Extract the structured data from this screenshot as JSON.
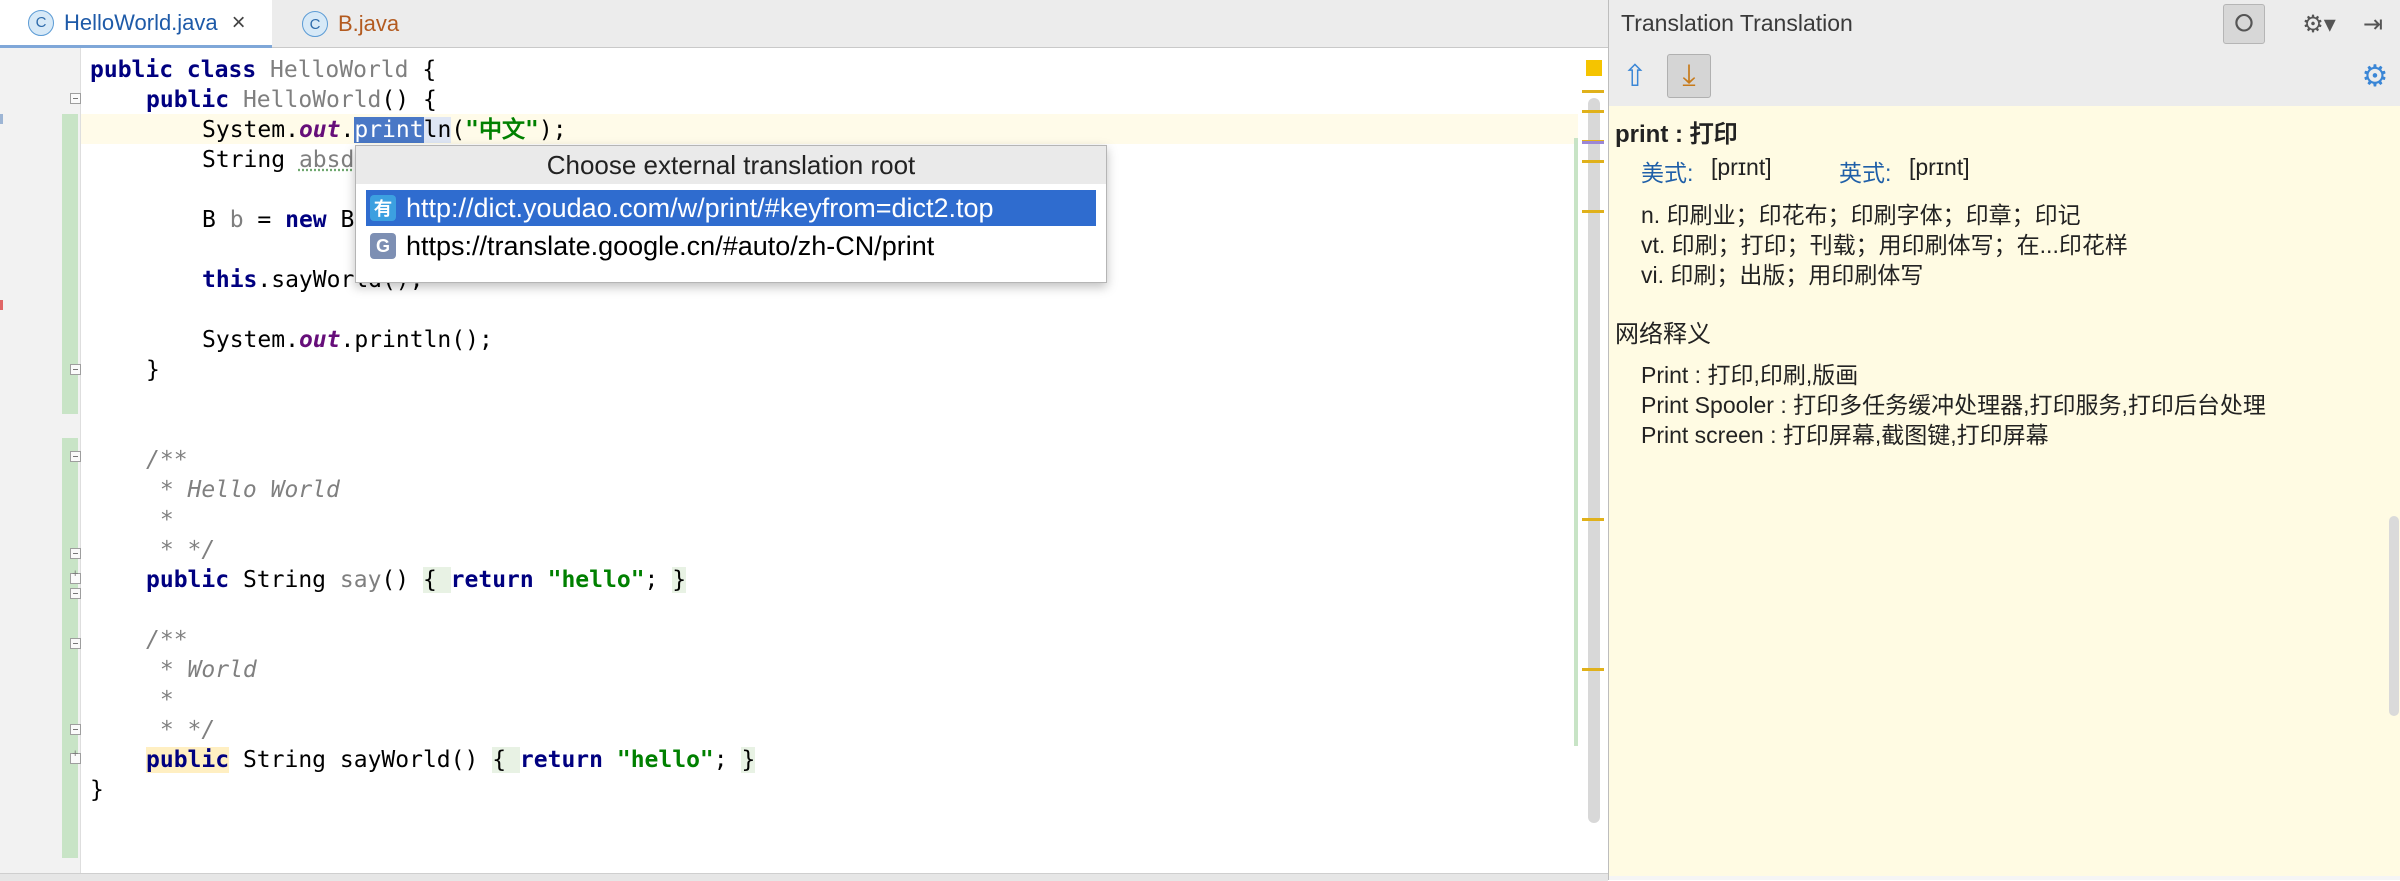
{
  "tabs": [
    {
      "label": "HelloWorld.java",
      "active": true
    },
    {
      "label": "B.java",
      "active": false
    }
  ],
  "code": {
    "l1": {
      "a": "public class ",
      "b": "HelloWorld",
      "c": " {"
    },
    "l2": {
      "a": "public ",
      "b": "HelloWorld",
      "c": "() {"
    },
    "l3": {
      "a": "System.",
      "b": "out",
      "c": ".",
      "sel": "print",
      "d": "ln",
      "e": "(",
      "str": "\"中文\"",
      "f": ");"
    },
    "l4": {
      "a": "String ",
      "b": "absd"
    },
    "l6": {
      "a": "B ",
      "b": "b",
      " c": "",
      "c2": " = ",
      "kw": "new",
      "d": " B"
    },
    "l8": {
      "kw": "this",
      "a": ".sayWorld();"
    },
    "l10": {
      "a": "System.",
      "b": "out",
      "c": ".println();"
    },
    "l11": "}",
    "l14": "/**",
    "l15": " * Hello World",
    "l16": " *",
    "l17": " * */",
    "l18": {
      "kw": "public ",
      "a": "String ",
      "b": "say",
      "c": "() ",
      "d": "{ ",
      "kw2": "return ",
      "str": "\"hello\"",
      "e": "; ",
      "f": "}"
    },
    "l20": "/**",
    "l21": " * World",
    "l22": " *",
    "l23": " * */",
    "l24": {
      "kw": "public",
      "a": " String sayWorld() ",
      "d": "{ ",
      "kw2": "return ",
      "str": "\"hello\"",
      "e": "; ",
      "f": "}"
    },
    "l25": "}"
  },
  "popup": {
    "title": "Choose external translation root",
    "items": [
      {
        "label": "http://dict.youdao.com/w/print/#keyfrom=dict2.top",
        "icon": "youdao-icon",
        "selected": true
      },
      {
        "label": "https://translate.google.cn/#auto/zh-CN/print",
        "icon": "google-translate-icon",
        "selected": false
      }
    ]
  },
  "translation": {
    "title": "Translation Translation",
    "heading": "print : 打印",
    "phonetic_us_label": "美式:",
    "phonetic_us": "[prɪnt]",
    "phonetic_uk_label": "英式:",
    "phonetic_uk": "[prɪnt]",
    "defs": [
      "n. 印刷业；印花布；印刷字体；印章；印记",
      "vt. 印刷；打印；刊载；用印刷体写；在...印花样",
      "vi. 印刷；出版；用印刷体写"
    ],
    "web_title": "网络释义",
    "web_defs": [
      "Print : 打印,印刷,版画",
      "Print Spooler : 打印多任务缓冲处理器,打印服务,打印后台处理",
      "Print screen : 打印屏幕,截图键,打印屏幕"
    ]
  },
  "colors": {
    "selection": "#2f6ccf",
    "panel_bg": "#fffbe3",
    "keyword": "#000080",
    "string": "#008000"
  }
}
